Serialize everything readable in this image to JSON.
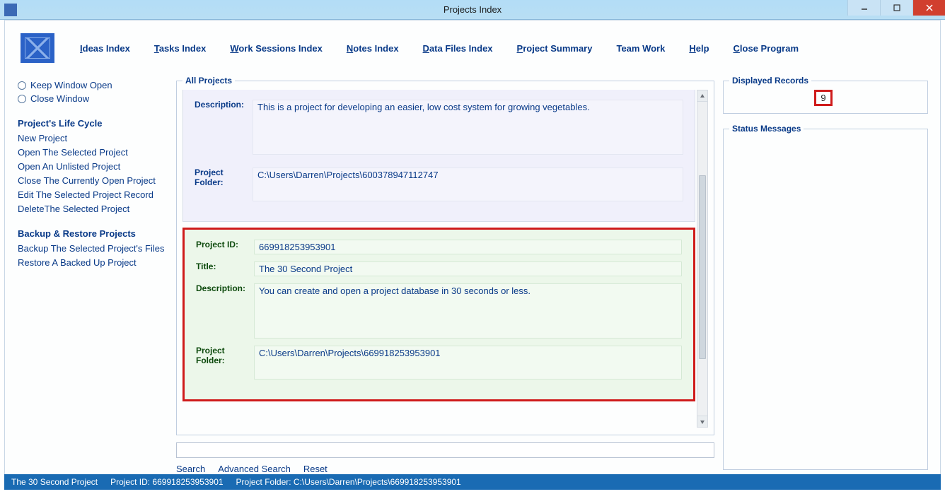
{
  "window": {
    "title": "Projects Index"
  },
  "menu": {
    "ideas": "deas Index",
    "tasks": "asks Index",
    "work": "ork Sessions Index",
    "notes": "otes Index",
    "data": "ata Files Index",
    "summary": "roject Summary",
    "team": "Team Work",
    "help": "elp",
    "close": "lose Program"
  },
  "sidebar": {
    "keep_open": "eep Window Open",
    "close_win": "lose Window",
    "life_cycle_head": "Project's Life Cycle",
    "new_project": "New Project",
    "open_selected": "Open The Selected Project",
    "open_unlisted": "Open An Unlisted Project",
    "close_current": "Close The Currently Open Project",
    "edit_selected": "Edit The Selected Project Record",
    "delete_selected": "DeleteThe Selected Project",
    "backup_head": "Backup & Restore Projects",
    "backup_files": "Backup The Selected Project's Files",
    "restore": "Restore A Backed Up Project"
  },
  "projects": {
    "legend": "All Projects",
    "labels": {
      "project_id": "Project ID:",
      "title": "Title:",
      "description": "Description:",
      "folder": "Project Folder:"
    },
    "card0": {
      "description": "This is a project for developing an easier, low cost system for growing vegetables.",
      "folder": "C:\\Users\\Darren\\Projects\\600378947112747"
    },
    "card1": {
      "id": "669918253953901",
      "title": "The 30 Second Project",
      "description": "You can create and open a project database in 30 seconds or less.",
      "folder": "C:\\Users\\Darren\\Projects\\669918253953901"
    }
  },
  "search": {
    "search_label": "earch",
    "advanced_label": "dvanced Search",
    "reset_label": "eset"
  },
  "right": {
    "displayed_legend": "Displayed Records",
    "count": "9",
    "status_legend": "Status Messages"
  },
  "statusbar": {
    "title": "The 30 Second Project",
    "project_id": "Project ID:  669918253953901",
    "folder": "Project Folder: C:\\Users\\Darren\\Projects\\669918253953901"
  }
}
